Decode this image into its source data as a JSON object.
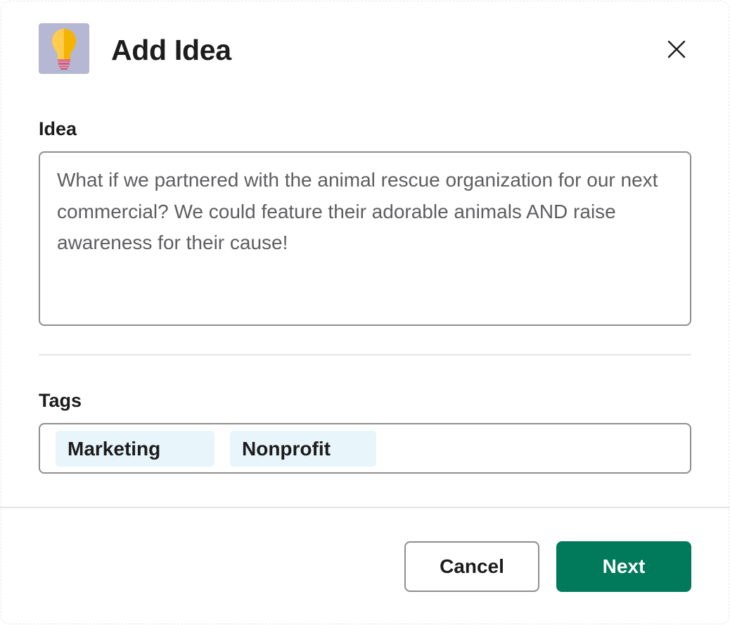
{
  "modal": {
    "title": "Add Idea",
    "app_icon": "lightbulb-icon",
    "close_icon": "close-icon"
  },
  "idea": {
    "label": "Idea",
    "value": "What if we partnered with the animal rescue organization for our next commercial? We could feature their adorable animals AND raise awareness for their cause!"
  },
  "tags": {
    "label": "Tags",
    "items": [
      "Marketing",
      "Nonprofit"
    ]
  },
  "footer": {
    "cancel_label": "Cancel",
    "next_label": "Next"
  },
  "colors": {
    "primary": "#007a5a",
    "chip_background": "#e8f5fa",
    "icon_background": "#b6b7d2"
  }
}
